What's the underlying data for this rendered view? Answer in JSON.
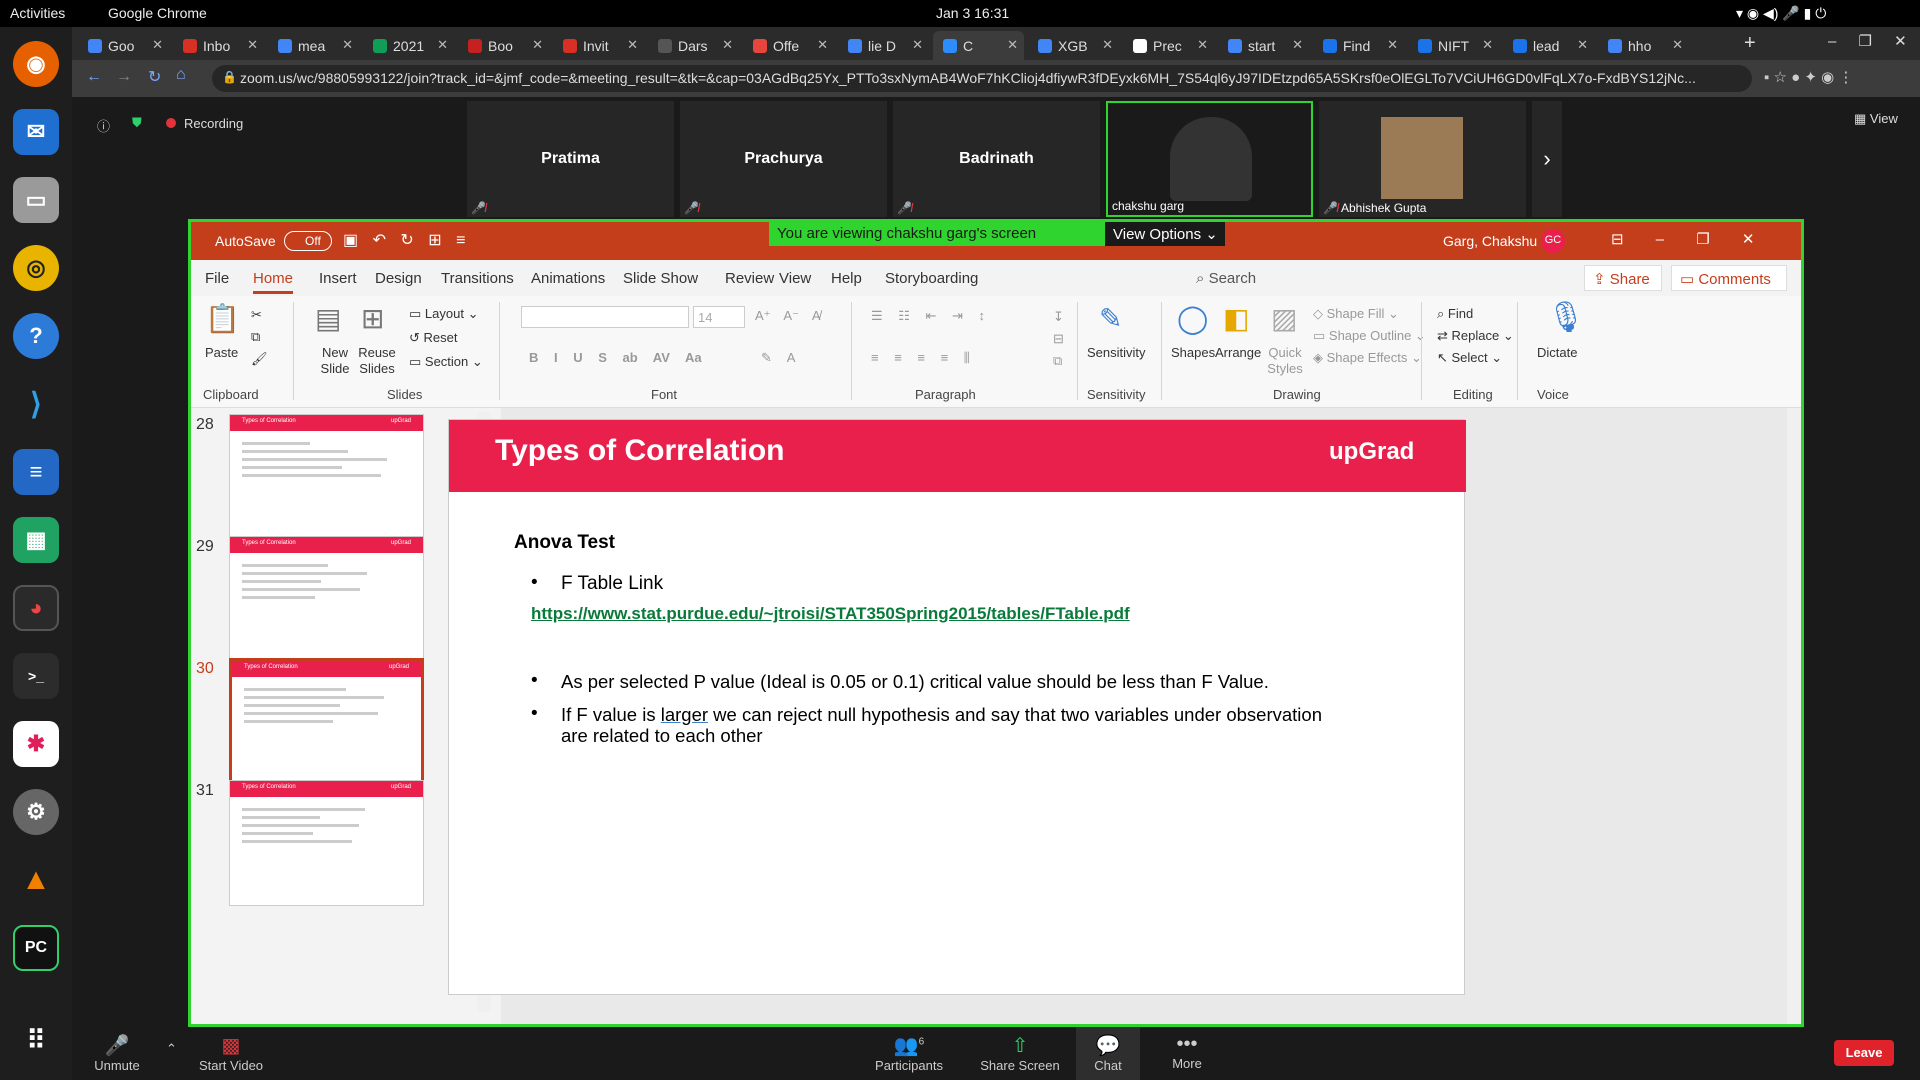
{
  "os": {
    "activities": "Activities",
    "app": "Google Chrome",
    "clock": "Jan 3  16:31"
  },
  "chrome": {
    "tabs": [
      "Goo",
      "Inbo",
      "mea",
      "2021",
      "Boo",
      "Invit",
      "Dars",
      "Offe",
      "lie D",
      "C",
      "XGB",
      "Prec",
      "start",
      "Find",
      "NIFT",
      "lead",
      "hho"
    ],
    "url": "zoom.us/wc/98805993122/join?track_id=&jmf_code=&meeting_result=&tk=&cap=03AGdBq25Yx_PTTo3sxNymAB4WoF7hKClioj4dfiywR3fDEyxk6MH_7S54ql6yJ97IDEtzpd65A5SKrsf0eOlEGLTo7VCiUH6GD0vlFqLX7o-FxdBYS12jNc..."
  },
  "zoom": {
    "recording": "Recording",
    "view": "View",
    "participants": [
      "Pratima",
      "Prachurya",
      "Badrinath",
      "chakshu garg",
      "Abhishek Gupta"
    ],
    "banner": "You are viewing chakshu garg's screen",
    "view_options": "View Options",
    "bottom": {
      "unmute": "Unmute",
      "start_video": "Start Video",
      "participants": "Participants",
      "participants_count": "6",
      "share": "Share Screen",
      "chat": "Chat",
      "more": "More",
      "leave": "Leave"
    }
  },
  "ppt": {
    "autosave": "AutoSave",
    "autosave_state": "Off",
    "user": "Garg, Chakshu",
    "initials": "GC",
    "menu": [
      "File",
      "Home",
      "Insert",
      "Design",
      "Transitions",
      "Animations",
      "Slide Show",
      "Review",
      "View",
      "Help",
      "Storyboarding"
    ],
    "search": "Search",
    "share": "Share",
    "comments": "Comments",
    "ribbon": {
      "paste": "Paste",
      "new_slide": "New Slide",
      "reuse": "Reuse Slides",
      "layout": "Layout",
      "reset": "Reset",
      "section": "Section",
      "font_size": "14",
      "sensitivity": "Sensitivity",
      "shapes": "Shapes",
      "arrange": "Arrange",
      "quick_styles": "Quick Styles",
      "shape_fill": "Shape Fill",
      "shape_outline": "Shape Outline",
      "shape_effects": "Shape Effects",
      "find": "Find",
      "replace": "Replace",
      "select": "Select",
      "dictate": "Dictate",
      "groups": [
        "Clipboard",
        "Slides",
        "Font",
        "Paragraph",
        "Sensitivity",
        "Drawing",
        "Editing",
        "Voice"
      ]
    },
    "thumb_nums": [
      "28",
      "29",
      "30",
      "31"
    ],
    "thumb_title": "Types  of Correlation",
    "thumb_brand": "upGrad",
    "slide": {
      "title": "Types  of Correlation",
      "brand": "upGrad",
      "heading": "Anova Test",
      "bullet1": "F Table Link",
      "link": "https://www.stat.purdue.edu/~jtroisi/STAT350Spring2015/tables/FTable.pdf",
      "bullet2": "As per selected P value (Ideal is 0.05 or 0.1) critical value should be less than F Value.",
      "bullet3a": "If F value is ",
      "bullet3b": "larger",
      "bullet3c": " we can reject null hypothesis and say that two variables under observation",
      "bullet3d": "are related to each other"
    }
  }
}
